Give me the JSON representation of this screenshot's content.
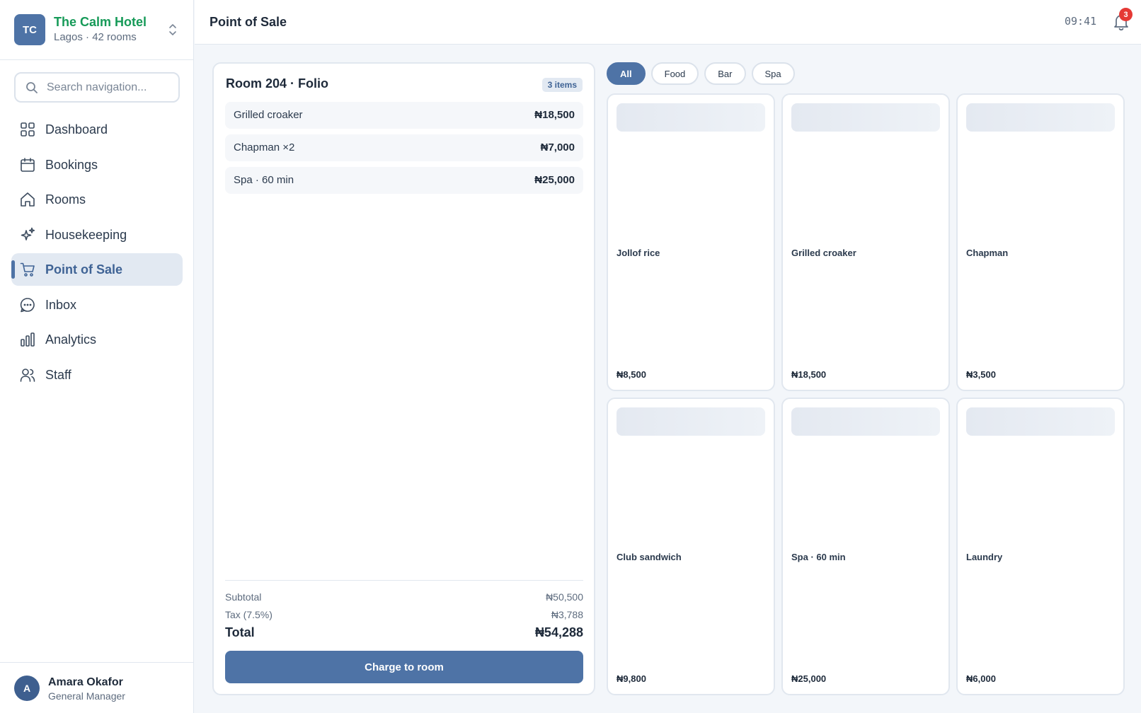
{
  "hotel": {
    "initials": "TC",
    "name": "The Calm Hotel",
    "subtitle": "Lagos · 42 rooms"
  },
  "search": {
    "placeholder": "Search navigation..."
  },
  "nav": {
    "items": [
      {
        "label": "Dashboard",
        "icon": "grid-icon"
      },
      {
        "label": "Bookings",
        "icon": "calendar-icon"
      },
      {
        "label": "Rooms",
        "icon": "home-icon"
      },
      {
        "label": "Housekeeping",
        "icon": "sparkle-icon"
      },
      {
        "label": "Point of Sale",
        "icon": "cart-icon",
        "active": true
      },
      {
        "label": "Inbox",
        "icon": "chat-icon"
      },
      {
        "label": "Analytics",
        "icon": "bar-chart-icon"
      },
      {
        "label": "Staff",
        "icon": "users-icon"
      }
    ]
  },
  "user": {
    "initial": "A",
    "name": "Amara Okafor",
    "role": "General Manager"
  },
  "header": {
    "title": "Point of Sale",
    "time": "09:41",
    "notifications": "3"
  },
  "folio": {
    "title": "Room 204 · Folio",
    "count": "3 items",
    "lines": [
      {
        "name": "Grilled croaker",
        "amount": "₦18,500"
      },
      {
        "name": "Chapman ×2",
        "amount": "₦7,000"
      },
      {
        "name": "Spa · 60 min",
        "amount": "₦25,000"
      }
    ],
    "subtotal_label": "Subtotal",
    "subtotal": "₦50,500",
    "tax_label": "Tax (7.5%)",
    "tax": "₦3,788",
    "total_label": "Total",
    "total": "₦54,288",
    "charge_label": "Charge to room"
  },
  "filters": [
    "All",
    "Food",
    "Bar",
    "Spa"
  ],
  "active_filter": "All",
  "products": [
    {
      "name": "Jollof rice",
      "price": "₦8,500"
    },
    {
      "name": "Grilled croaker",
      "price": "₦18,500"
    },
    {
      "name": "Chapman",
      "price": "₦3,500"
    },
    {
      "name": "Club sandwich",
      "price": "₦9,800"
    },
    {
      "name": "Spa · 60 min",
      "price": "₦25,000"
    },
    {
      "name": "Laundry",
      "price": "₦6,000"
    }
  ],
  "colors": {
    "accent": "#4e73a6",
    "brand": "#169a58",
    "alert": "#e53935"
  }
}
